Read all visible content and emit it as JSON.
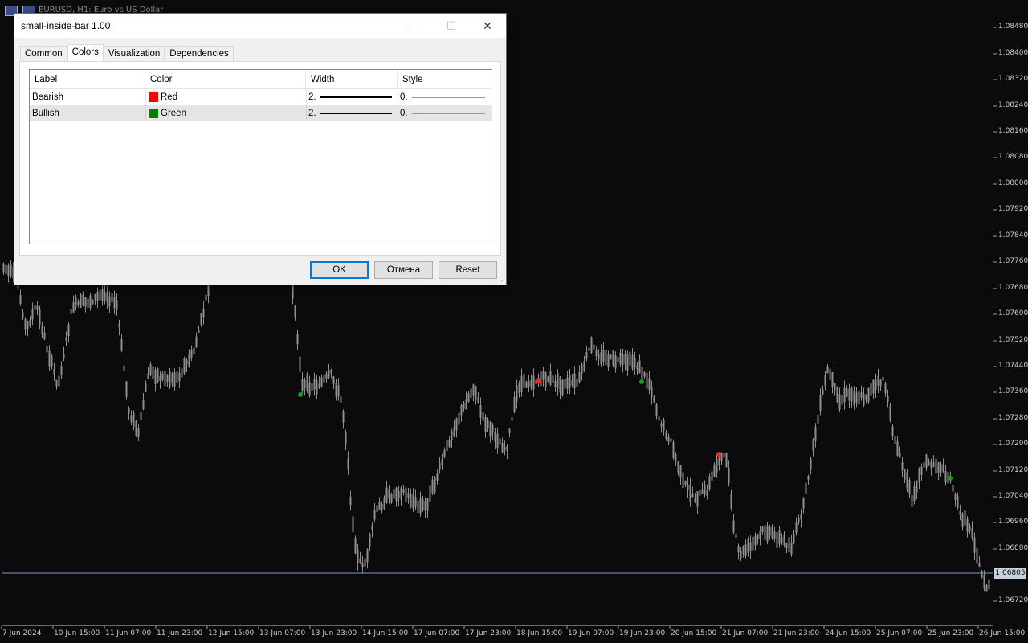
{
  "chart": {
    "title": "EURUSD, H1: Euro vs US Dollar",
    "current_price": "1.06805",
    "price_ticks": [
      "1.08480",
      "1.08400",
      "1.08320",
      "1.08240",
      "1.08160",
      "1.08080",
      "1.08000",
      "1.07920",
      "1.07840",
      "1.07760",
      "1.07680",
      "1.07600",
      "1.07520",
      "1.07440",
      "1.07360",
      "1.07280",
      "1.07200",
      "1.07120",
      "1.07040",
      "1.06960",
      "1.06880",
      "1.06720"
    ],
    "time_ticks": [
      "7 Jun 2024",
      "10 Jun 15:00",
      "11 Jun 07:00",
      "11 Jun 23:00",
      "12 Jun 15:00",
      "13 Jun 07:00",
      "13 Jun 23:00",
      "14 Jun 15:00",
      "17 Jun 07:00",
      "17 Jun 23:00",
      "18 Jun 15:00",
      "19 Jun 07:00",
      "19 Jun 23:00",
      "20 Jun 15:00",
      "21 Jun 07:00",
      "21 Jun 23:00",
      "24 Jun 15:00",
      "25 Jun 07:00",
      "25 Jun 23:00",
      "26 Jun 15:00"
    ],
    "colors": {
      "background": "#0b0b0e",
      "candle": "#8f8f8f",
      "bearish": "#ff2020",
      "bullish": "#1f9a1f",
      "price_line": "#7e9aa8"
    }
  },
  "dialog": {
    "title": "small-inside-bar 1.00",
    "window_buttons": {
      "minimize": "—",
      "maximize": "☐",
      "close": "✕"
    },
    "tabs": [
      {
        "label": "Common",
        "active": false
      },
      {
        "label": "Colors",
        "active": true
      },
      {
        "label": "Visualization",
        "active": false
      },
      {
        "label": "Dependencies",
        "active": false
      }
    ],
    "grid": {
      "headers": {
        "label": "Label",
        "color": "Color",
        "width": "Width",
        "style": "Style"
      },
      "rows": [
        {
          "label": "Bearish",
          "color_name": "Red",
          "swatch": "#ff0000",
          "width": "2.",
          "style": "0."
        },
        {
          "label": "Bullish",
          "color_name": "Green",
          "swatch": "#008000",
          "width": "2.",
          "style": "0."
        }
      ]
    },
    "buttons": {
      "ok": "OK",
      "cancel": "Отмена",
      "reset": "Reset"
    }
  }
}
